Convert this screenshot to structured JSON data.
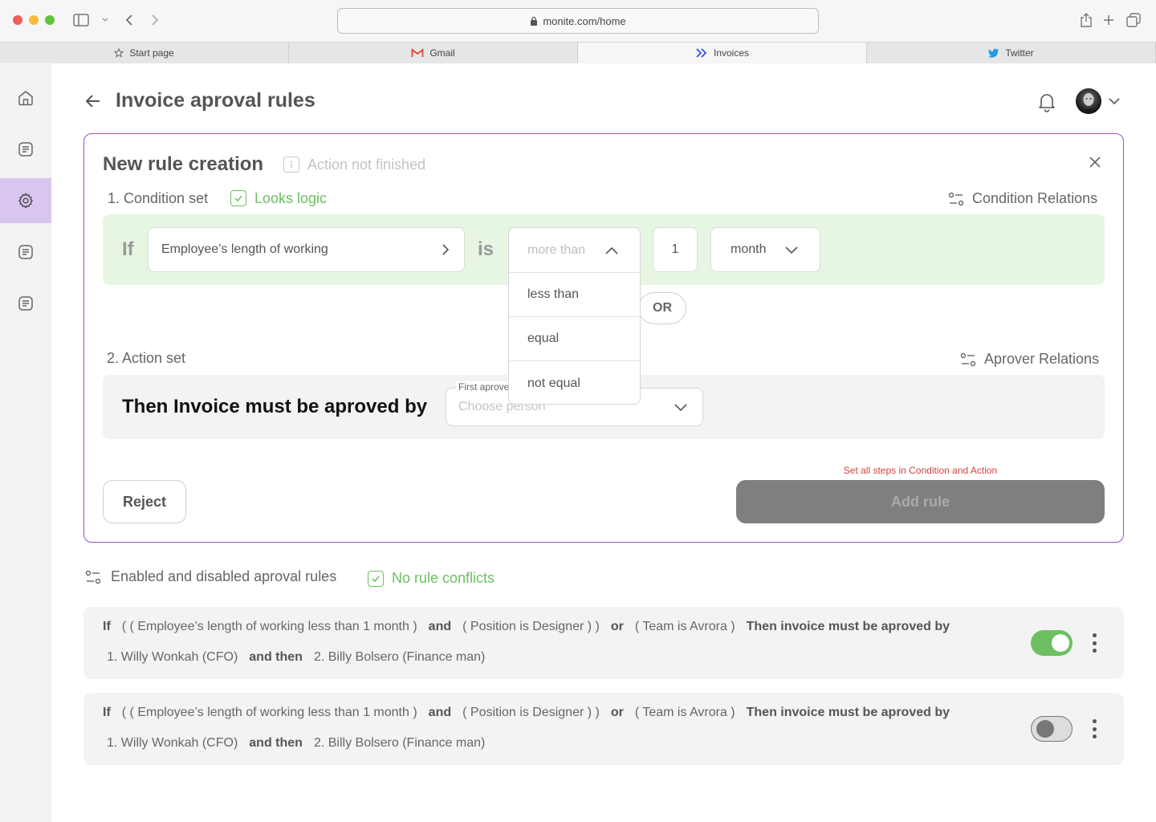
{
  "browser": {
    "url": "monite.com/home",
    "tabs": [
      {
        "label": "Start page",
        "icon": "star-icon"
      },
      {
        "label": "Gmail",
        "icon": "gmail-icon"
      },
      {
        "label": "Invoices",
        "icon": "monite-icon"
      },
      {
        "label": "Twitter",
        "icon": "twitter-icon"
      }
    ],
    "active_tab": "Invoices"
  },
  "sidebar": {
    "items": [
      {
        "icon": "home-icon"
      },
      {
        "icon": "document-icon"
      },
      {
        "icon": "gear-icon",
        "active": true
      },
      {
        "icon": "document-icon"
      },
      {
        "icon": "document-icon"
      }
    ],
    "active_color": "#d9c6f0"
  },
  "header": {
    "title": "Invoice aproval rules"
  },
  "rule_form": {
    "title": "New rule creation",
    "status": "Action not finished",
    "condition": {
      "label": "1. Condition set",
      "check_text": "Looks logic",
      "relations_label": "Condition Relations",
      "if_word": "If",
      "field_value": "Employee’s length of working",
      "is_word": "is",
      "operator": {
        "selected": "more than",
        "options": [
          "less than",
          "equal",
          "not equal"
        ]
      },
      "amount": "1",
      "unit": "month",
      "or_label": "OR"
    },
    "action": {
      "label": "2. Action set",
      "relations_label": "Aprover Relations",
      "text": "Then Invoice must be aproved by",
      "select_legend": "First aprover",
      "select_placeholder": "Choose person"
    },
    "reject_label": "Reject",
    "add_label": "Add rule",
    "hint": "Set all steps in Condition and Action"
  },
  "rules": {
    "heading": "Enabled and disabled aproval rules",
    "conflict_text": "No rule conflicts",
    "items": [
      {
        "if_word": "If",
        "clause1": "( ( Employee’s length of working less than 1 month )",
        "and_word": "and",
        "clause2": "( Position is Designer ) )",
        "or_word": "or",
        "clause3": "( Team is Avrora )",
        "then_text": "Then invoice must be aproved by",
        "approver1": "1. Willy Wonkah (CFO)",
        "and_then": "and then",
        "approver2": "2. Billy Bolsero (Finance man)",
        "enabled": true
      },
      {
        "if_word": "If",
        "clause1": "( ( Employee’s length of working less than 1 month )",
        "and_word": "and",
        "clause2": "( Position is Designer ) )",
        "or_word": "or",
        "clause3": "( Team is Avrora )",
        "then_text": "Then invoice must be aproved by",
        "approver1": "1. Willy Wonkah (CFO)",
        "and_then": "and then",
        "approver2": "2. Billy Bolsero (Finance man)",
        "enabled": false
      }
    ]
  },
  "colors": {
    "accent": "#9b4fc4",
    "success": "#6cc061",
    "error": "#d0453c",
    "condition_bg": "#e7f5e3"
  }
}
